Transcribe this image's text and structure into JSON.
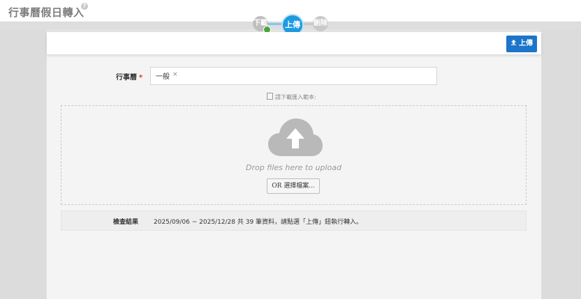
{
  "header": {
    "title": "行事曆假日轉入",
    "help_icon": "?"
  },
  "steps": [
    {
      "label": "下載",
      "state": "done"
    },
    {
      "label": "上傳",
      "state": "active"
    },
    {
      "label": "刪除",
      "state": "pending"
    }
  ],
  "toolbar": {
    "upload_label": "上傳"
  },
  "form": {
    "calendar_label": "行事曆",
    "required_mark": "*",
    "calendar_tag": "一般",
    "tag_remove": "×"
  },
  "template_hint": "請下載匯入範本:",
  "dropzone": {
    "message": "Drop files here to upload",
    "choose_button": "OR 選擇檔案..."
  },
  "result": {
    "label": "檢查結果",
    "text": "2025/09/06 ~ 2025/12/28 共 39 筆資料，請點選「上傳」鈕執行轉入。"
  },
  "colors": {
    "accent": "#1e9be0",
    "button": "#1d75c9",
    "done": "#4aa63c"
  }
}
